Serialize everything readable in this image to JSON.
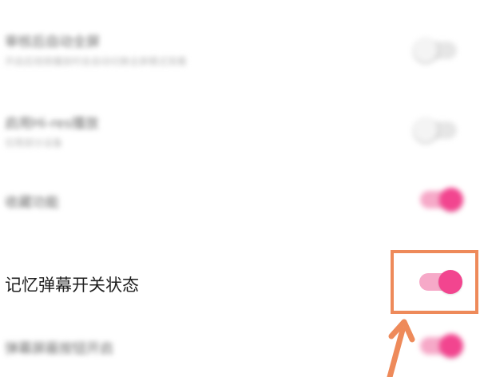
{
  "settings": {
    "items": [
      {
        "label": "审核后自动全屏",
        "sub": "开启后视频播放时会自动切换全屏模式观看",
        "state": "off",
        "blurred": true
      },
      {
        "label": "启用Hi-res播放",
        "sub": "仅限部分设备",
        "state": "off",
        "blurred": true
      },
      {
        "label": "收藏功能",
        "sub": "",
        "state": "on",
        "blurred": true
      },
      {
        "label": "记忆弹幕开关状态",
        "sub": "",
        "state": "on",
        "blurred": false
      },
      {
        "label": "弹幕屏蔽按钮开启",
        "sub": "",
        "state": "on",
        "blurred": true
      }
    ]
  },
  "colors": {
    "toggle_on_track": "#f6a9c8",
    "toggle_on_knob": "#f2458f",
    "toggle_off_track": "#e6e6e6",
    "annotation": "#ee8a5a"
  },
  "annotation": {
    "icon": "arrow-up-icon"
  }
}
